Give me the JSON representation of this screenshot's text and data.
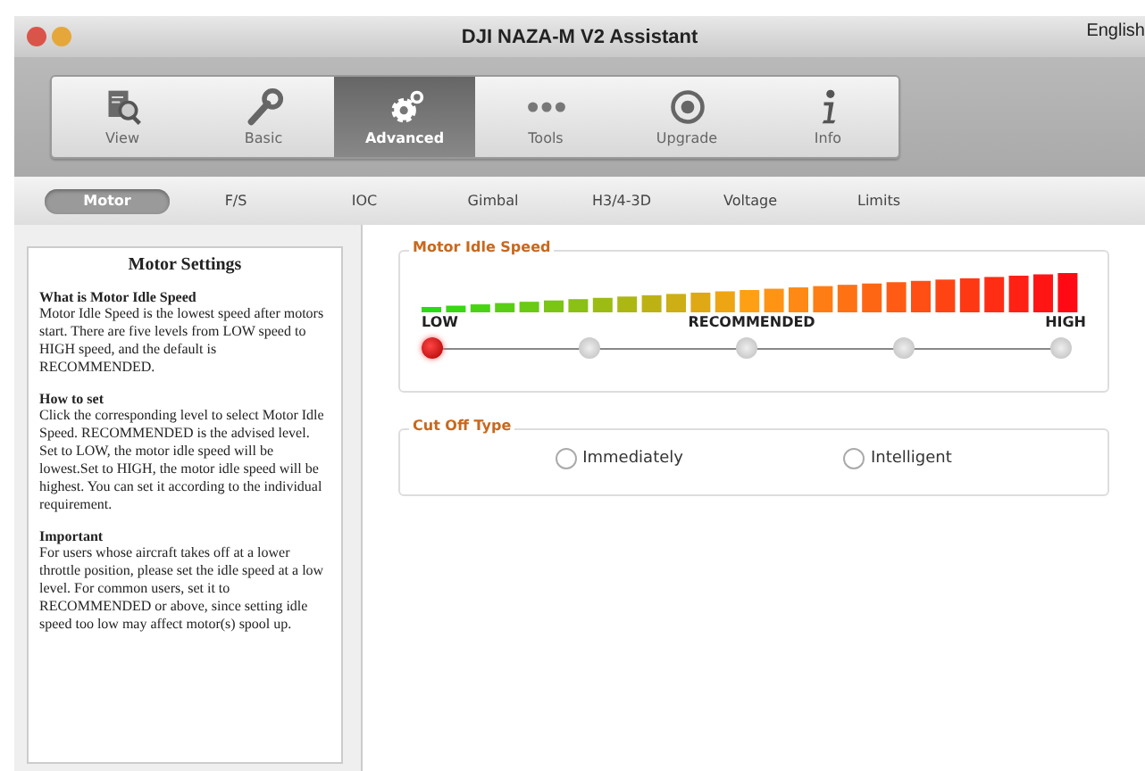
{
  "window": {
    "title": "DJI NAZA-M V2 Assistant",
    "language": "English"
  },
  "toolbar": [
    {
      "label": "View",
      "kind": "view",
      "selected": false
    },
    {
      "label": "Basic",
      "kind": "basic",
      "selected": false
    },
    {
      "label": "Advanced",
      "kind": "advanced",
      "selected": true
    },
    {
      "label": "Tools",
      "kind": "tools",
      "selected": false
    },
    {
      "label": "Upgrade",
      "kind": "upgrade",
      "selected": false
    },
    {
      "label": "Info",
      "kind": "info",
      "selected": false
    }
  ],
  "subtabs": [
    {
      "label": "Motor",
      "selected": true
    },
    {
      "label": "F/S",
      "selected": false
    },
    {
      "label": "IOC",
      "selected": false
    },
    {
      "label": "Gimbal",
      "selected": false
    },
    {
      "label": "H3/4-3D",
      "selected": false
    },
    {
      "label": "Voltage",
      "selected": false
    },
    {
      "label": "Limits",
      "selected": false
    }
  ],
  "help": {
    "title": "Motor Settings",
    "sections": [
      {
        "heading": "What is Motor Idle Speed",
        "text": "Motor Idle Speed is the lowest speed after motors start. There are five levels from LOW speed to HIGH speed, and the default is RECOMMENDED."
      },
      {
        "heading": "How to set",
        "text": "Click the corresponding level to select Motor Idle Speed. RECOMMENDED is the advised level. Set to LOW, the motor idle speed will be lowest.Set to HIGH, the motor idle speed will be highest. You can set it according to the individual requirement."
      },
      {
        "heading": "Important",
        "text": "For users whose aircraft takes off at a lower throttle position, please set the idle speed at a low level. For common users, set it to RECOMMENDED or above, since setting idle speed too low may affect motor(s) spool up."
      }
    ]
  },
  "idle_speed": {
    "title": "Motor Idle Speed",
    "labels": [
      "LOW",
      "RECOMMENDED",
      "HIGH"
    ],
    "levels": [
      {
        "selected": true
      },
      {
        "selected": false
      },
      {
        "selected": false
      },
      {
        "selected": false
      },
      {
        "selected": false
      }
    ]
  },
  "cut_off": {
    "title": "Cut Off Type",
    "options": [
      {
        "label": "Immediately",
        "selected": false
      },
      {
        "label": "Intelligent",
        "selected": false
      }
    ]
  }
}
